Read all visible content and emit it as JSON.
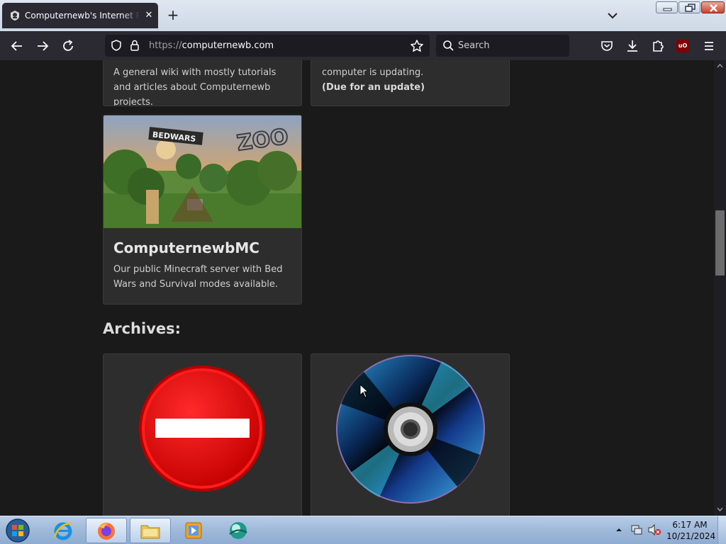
{
  "browser": {
    "tab_title": "Computernewb's Internet Pub",
    "tab_close": "✕",
    "new_tab": "+",
    "url_scheme": "https://",
    "url_host": "computernewb.com",
    "search_placeholder": "Search",
    "ublock_label": "uO"
  },
  "cards_top": [
    {
      "text": "A general wiki with mostly tutorials and articles about Computernewb projects."
    },
    {
      "text": "computer is updating.",
      "bold": "(Due for an update)"
    }
  ],
  "mc_card": {
    "image_labels": {
      "sign": "BEDWARS",
      "zoo": "ZOO"
    },
    "title": "ComputernewbMC",
    "text": "Our public Minecraft server with Bed Wars and Survival modes available."
  },
  "archives_heading": "Archives:",
  "taskbar": {
    "time": "6:17 AM",
    "date": "10/21/2024"
  },
  "colors": {
    "browser_chrome": "#2b2a33",
    "page_bg": "#1a1a1a",
    "card_bg": "#2d2d2d",
    "taskbar": "#9fb9d9"
  }
}
